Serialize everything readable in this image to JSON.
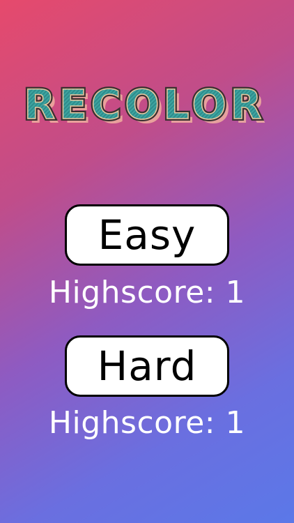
{
  "title": {
    "text": "RECOLOR",
    "face_color": "#2e8c8c",
    "outline_color": "#3a3030",
    "shadow_color": "#f0b0a0"
  },
  "modes": [
    {
      "label": "Easy",
      "highscore_label": "Highscore:",
      "highscore_value": "1"
    },
    {
      "label": "Hard",
      "highscore_label": "Highscore:",
      "highscore_value": "1"
    }
  ],
  "colors": {
    "gradient_top_left": "#e64a6c",
    "gradient_bottom_right": "#5b78e8",
    "button_bg": "#ffffff",
    "button_border": "#000000",
    "highscore_text": "#ffffff"
  }
}
